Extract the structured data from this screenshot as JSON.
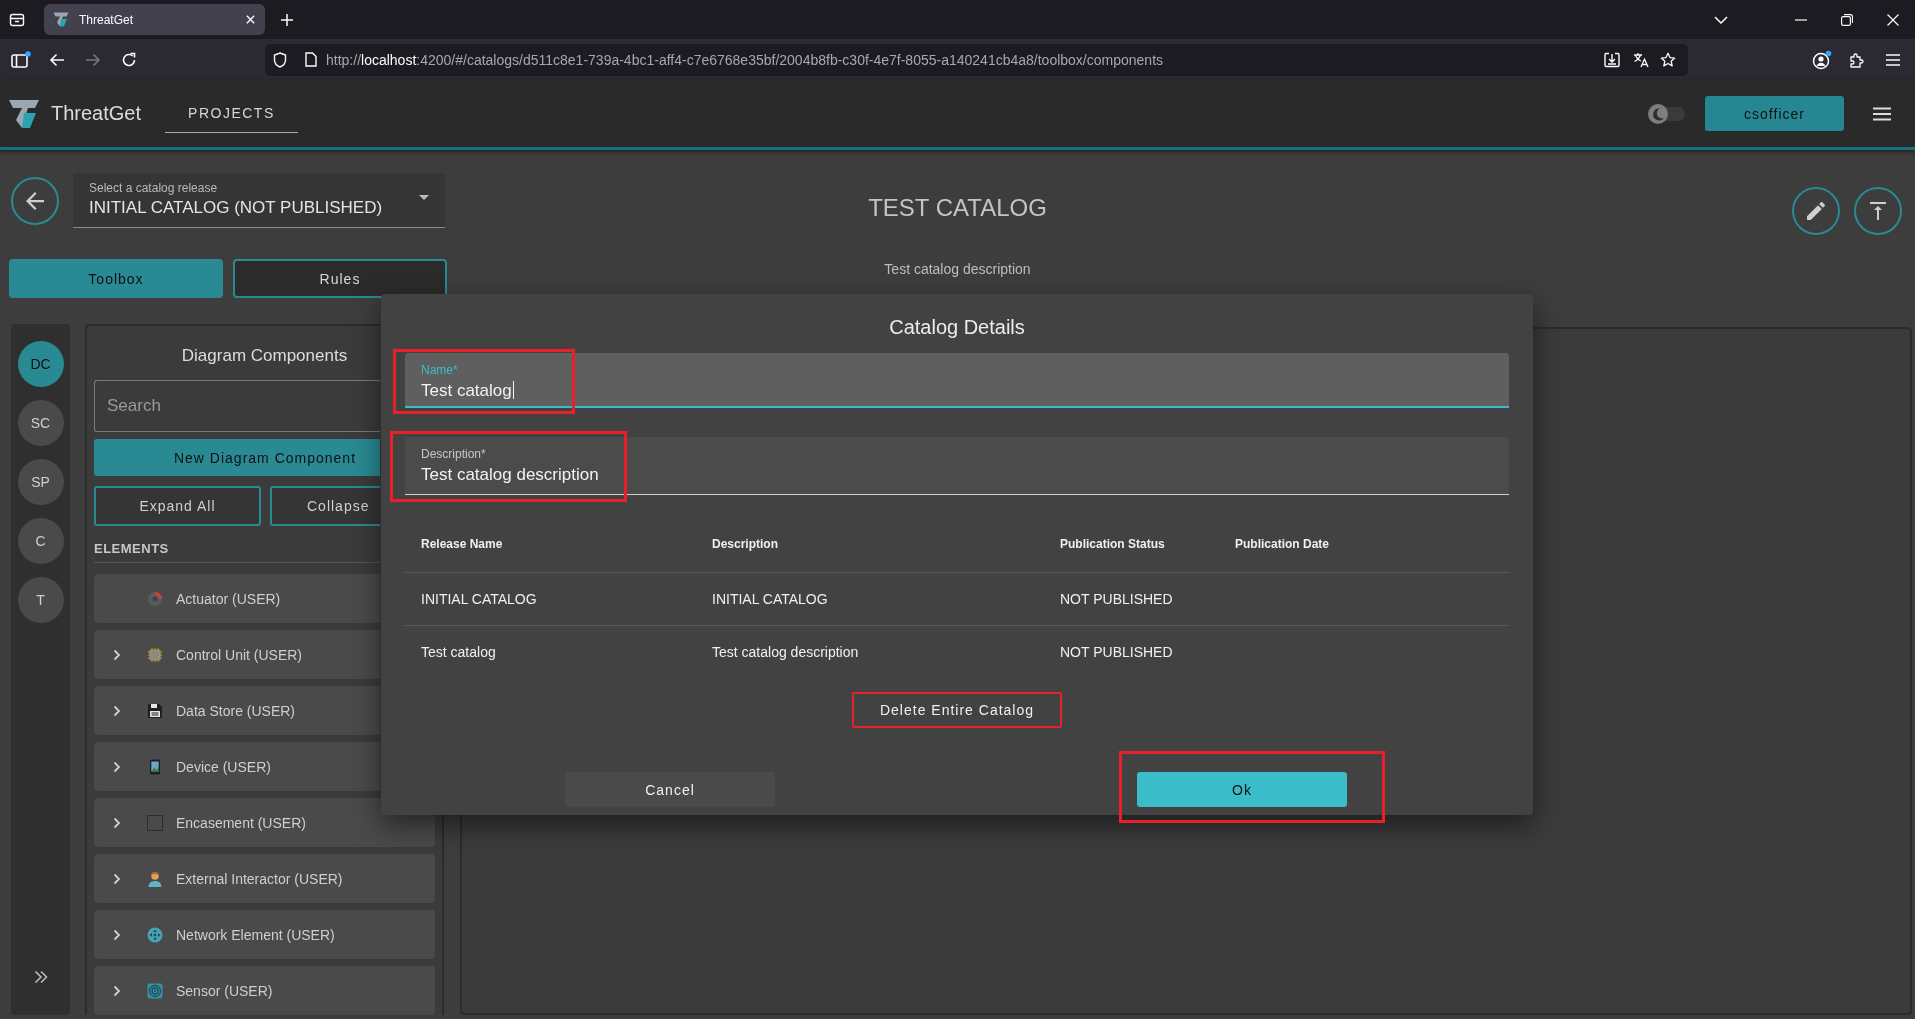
{
  "browser": {
    "tabs": [
      {
        "title": "ThreatGet",
        "selected": true
      }
    ],
    "forward_button": {
      "disabled": true
    },
    "address": {
      "scheme": "http://",
      "host": "localhost",
      "path": ":4200/#/catalogs/d511c8e1-739a-4bc1-aff4-c7e6768e35bf/2004b8fb-c30f-4e7f-8055-a140241cb4a8/toolbox/components"
    }
  },
  "app_header": {
    "brand": "ThreatGet",
    "nav": [
      {
        "label": "PROJECTS",
        "selected": true
      }
    ],
    "theme_toggle": {
      "on": false
    },
    "user_button": "csofficer"
  },
  "catalog_header": {
    "release_select": {
      "label": "Select a catalog release",
      "value": "INITIAL CATALOG (NOT PUBLISHED)"
    },
    "title": "TEST CATALOG",
    "description": "Test catalog description"
  },
  "view_tabs": [
    {
      "label": "Toolbox",
      "selected": true
    },
    {
      "label": "Rules",
      "selected": false
    }
  ],
  "section_rail": [
    {
      "label": "DC",
      "selected": true
    },
    {
      "label": "SC",
      "selected": false
    },
    {
      "label": "SP",
      "selected": false
    },
    {
      "label": "C",
      "selected": false
    },
    {
      "label": "T",
      "selected": false
    }
  ],
  "components_panel": {
    "title": "Diagram Components",
    "search": {
      "placeholder": "Search"
    },
    "new_button": "New Diagram Component",
    "expand_button": "Expand All",
    "collapse_button": "Collapse",
    "section": "ELEMENTS",
    "items": [
      {
        "label": "Actuator (USER)",
        "expandable": false
      },
      {
        "label": "Control Unit (USER)",
        "expandable": true
      },
      {
        "label": "Data Store (USER)",
        "expandable": true
      },
      {
        "label": "Device (USER)",
        "expandable": true
      },
      {
        "label": "Encasement (USER)",
        "expandable": true
      },
      {
        "label": "External Interactor (USER)",
        "expandable": true
      },
      {
        "label": "Network Element (USER)",
        "expandable": true
      },
      {
        "label": "Sensor (USER)",
        "expandable": true
      }
    ]
  },
  "catalog_dialog": {
    "title": "Catalog Details",
    "fields": [
      {
        "label": "Name*",
        "value": "Test catalog",
        "focused": true,
        "highlighted": true
      },
      {
        "label": "Description*",
        "value": "Test catalog description",
        "focused": false,
        "highlighted": true
      }
    ],
    "table": {
      "columns": [
        "Release Name",
        "Description",
        "Publication Status",
        "Publication Date"
      ],
      "rows": [
        [
          "INITIAL CATALOG",
          "INITIAL CATALOG",
          "NOT PUBLISHED"
        ],
        [
          "Test catalog",
          "Test catalog description",
          "NOT PUBLISHED"
        ]
      ]
    },
    "delete_button": {
      "label": "Delete Entire Catalog",
      "highlighted": true
    },
    "actions": [
      {
        "label": "Cancel",
        "kind": "secondary",
        "highlighted": false
      },
      {
        "label": "Ok",
        "kind": "primary",
        "highlighted": true
      }
    ]
  }
}
